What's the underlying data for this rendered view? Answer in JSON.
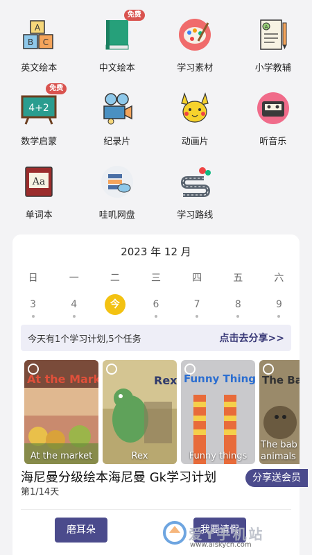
{
  "grid": [
    {
      "label": "英文绘本",
      "icon": "abc-blocks-icon",
      "badge": ""
    },
    {
      "label": "中文绘本",
      "icon": "green-book-icon",
      "badge": "免费"
    },
    {
      "label": "学习素材",
      "icon": "paint-palette-icon",
      "badge": ""
    },
    {
      "label": "小学教辅",
      "icon": "test-paper-icon",
      "badge": ""
    },
    {
      "label": "数学启蒙",
      "icon": "math-board-icon",
      "badge": "免费"
    },
    {
      "label": "纪录片",
      "icon": "movie-camera-icon",
      "badge": ""
    },
    {
      "label": "动画片",
      "icon": "pikachu-icon",
      "badge": ""
    },
    {
      "label": "听音乐",
      "icon": "cassette-icon",
      "badge": ""
    },
    {
      "label": "单词本",
      "icon": "dictionary-icon",
      "badge": ""
    },
    {
      "label": "哇叽网盘",
      "icon": "cloud-server-icon",
      "badge": ""
    },
    {
      "label": "学习路线",
      "icon": "route-map-icon",
      "badge": ""
    }
  ],
  "calendar": {
    "month": "2023 年 12 月",
    "weekdays": [
      "日",
      "一",
      "二",
      "三",
      "四",
      "五",
      "六"
    ],
    "days": [
      "3",
      "4",
      "今",
      "6",
      "7",
      "8",
      "9"
    ],
    "today_index": 2
  },
  "plan_bar": {
    "text": "今天有1个学习计划,5个任务",
    "share": "点击去分享>>"
  },
  "books": [
    {
      "title": "At the Market",
      "caption": "At the market"
    },
    {
      "title": "Rex",
      "caption": "Rex"
    },
    {
      "title": "Funny Things",
      "caption": "Funny things"
    },
    {
      "title": "The Bab",
      "caption": "The bab animals"
    }
  ],
  "plan": {
    "title": "海尼曼分级绘本海尼曼 Gk学习计划",
    "progress": "第1/14天",
    "share_pill": "分享送会员"
  },
  "buttons": {
    "dog_ear": "磨耳朵",
    "leave": "我要请假"
  },
  "watermark": {
    "text": "爱Y手机站",
    "url": "www.aiskycn.com"
  },
  "colors": {
    "accent": "#4b4b8c",
    "today": "#f3c212",
    "badge": "#d9534f"
  }
}
